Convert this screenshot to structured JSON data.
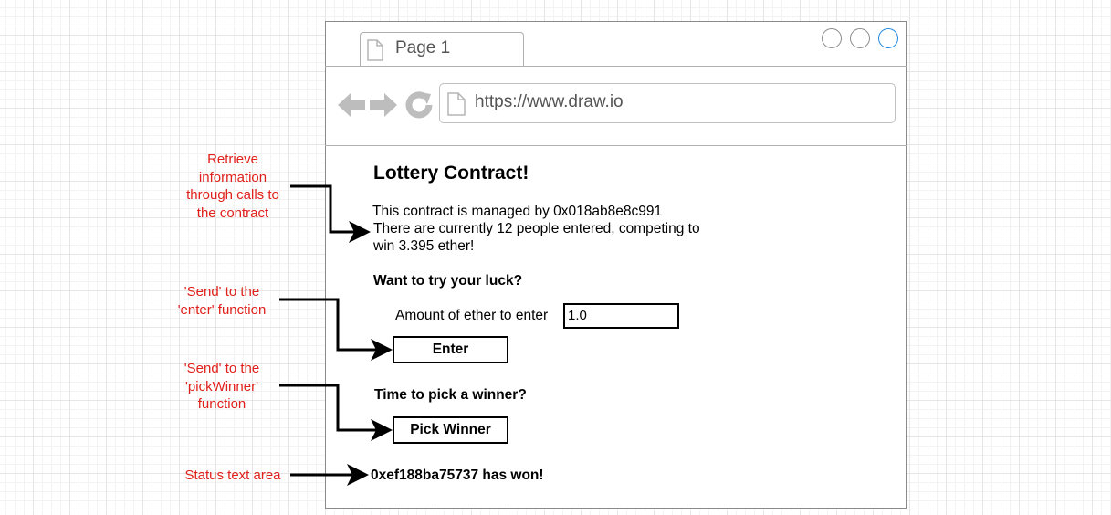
{
  "browser": {
    "tab_label": "Page 1",
    "url": "https://www.draw.io",
    "accent": "#1e88e5"
  },
  "app": {
    "title": "Lottery Contract!",
    "manager_line": "This contract is managed by 0x018ab8e8c991",
    "players_line_1": "There are currently 12 people entered, competing to",
    "players_line_2": "win 3.395 ether!",
    "enter_section_title": "Want to try your luck?",
    "amount_label": "Amount of ether to enter",
    "amount_value": "1.0",
    "enter_button": "Enter",
    "winner_section_title": "Time to pick a winner?",
    "pick_winner_button": "Pick Winner",
    "status_text": "0xef188ba75737 has won!"
  },
  "annotations": {
    "retrieve": [
      "Retrieve",
      "information",
      "through calls to",
      "the contract"
    ],
    "send_enter": [
      "'Send' to the",
      "'enter' function"
    ],
    "send_pick": [
      "'Send' to the",
      "'pickWinner'",
      "function"
    ],
    "status": "Status text area",
    "color": "#e0201a"
  }
}
